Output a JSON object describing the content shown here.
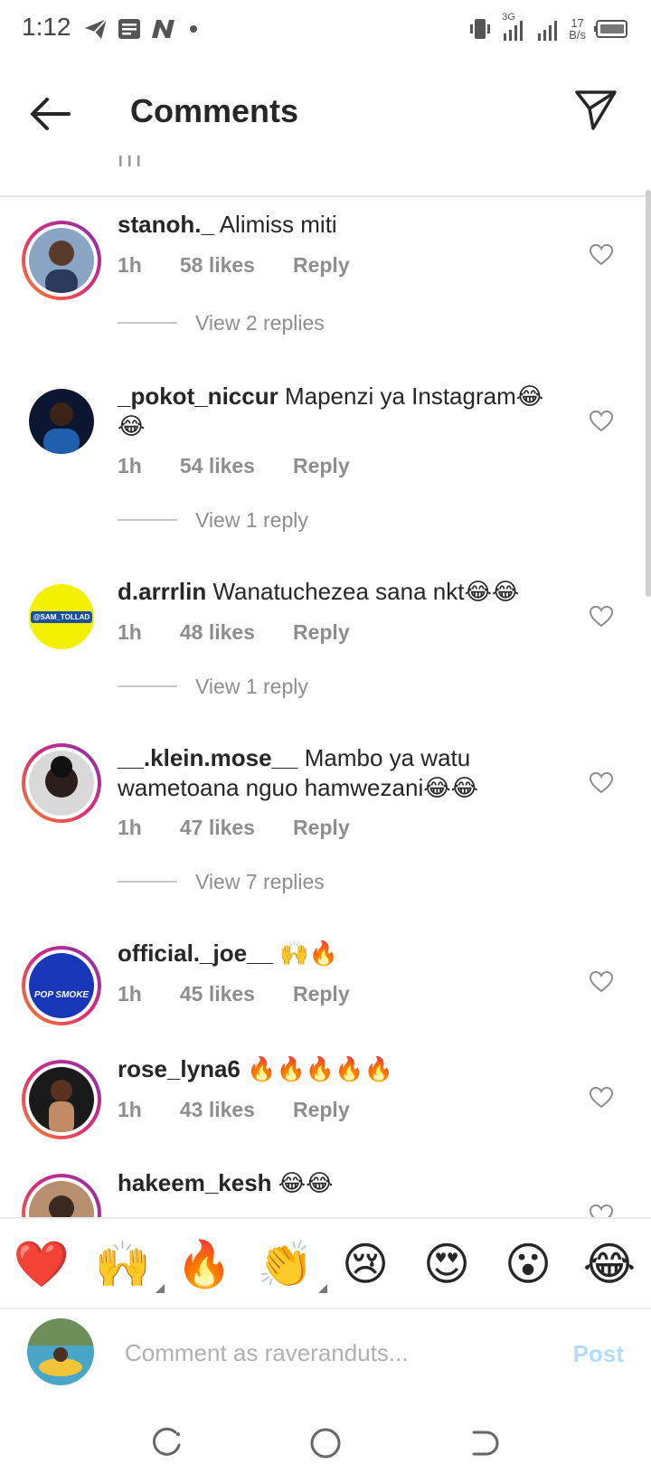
{
  "status_bar": {
    "time": "1:12",
    "network_type": "3G",
    "net_speed_value": "17",
    "net_speed_unit": "B/s"
  },
  "header": {
    "title": "Comments"
  },
  "comments": [
    {
      "username": "stanoh._",
      "text": "Alimiss miti",
      "time": "1h",
      "likes": "58 likes",
      "reply_label": "Reply",
      "view_replies": "View 2 replies"
    },
    {
      "username": "_pokot_niccur",
      "text": "Mapenzi ya Instagram😂😂",
      "time": "1h",
      "likes": "54 likes",
      "reply_label": "Reply",
      "view_replies": "View 1 reply"
    },
    {
      "username": "d.arrrlin",
      "text": "Wanatuchezea sana nkt😂😂",
      "time": "1h",
      "likes": "48 likes",
      "reply_label": "Reply",
      "view_replies": "View 1 reply",
      "avatar_text": "@SAM_TOLLAD"
    },
    {
      "username": "__.klein.mose__",
      "text": "Mambo ya watu wametoana nguo hamwezani😂😂",
      "time": "1h",
      "likes": "47 likes",
      "reply_label": "Reply",
      "view_replies": "View 7 replies"
    },
    {
      "username": "official._joe__",
      "text": "🙌🔥",
      "time": "1h",
      "likes": "45 likes",
      "reply_label": "Reply",
      "avatar_text": "POP SMOKE"
    },
    {
      "username": "rose_lyna6",
      "text": "🔥🔥🔥🔥🔥",
      "time": "1h",
      "likes": "43 likes",
      "reply_label": "Reply"
    },
    {
      "username": "hakeem_kesh",
      "text": "😂😂"
    }
  ],
  "emoji_bar": [
    "❤️",
    "🙌",
    "🔥",
    "👏",
    "😢",
    "😍",
    "😮",
    "😂"
  ],
  "comment_input": {
    "placeholder": "Comment as raveranduts...",
    "post_label": "Post"
  },
  "colors": {
    "accent_disabled": "#b3dbff",
    "meta_gray": "#8e8e8e",
    "story_ring_start": "#f58529",
    "story_ring_end": "#dd2a7b"
  }
}
